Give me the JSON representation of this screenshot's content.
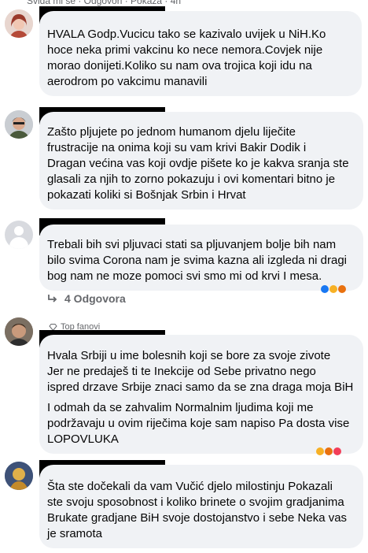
{
  "top_actions": {
    "text": "Sviđa mi se · Odgovori · Pokaža · 4n"
  },
  "comments": [
    {
      "text": "HVALA Godp.Vucicu tako se kazivalo uvijek u NiH.Ko\nhoce neka primi vakcinu ko nece nemora.Covjek nije\nmorao donijeti.Koliko su nam ova trojica koji idu na\naerodrom po vakcimu manavili"
    },
    {
      "text": "Zašto pljujete po jednom humanom djelu liječite\nfrustracije na onima koji su vam krivi Bakir Dodik i\nDragan većina vas koji ovdje pišete ko je kakva sranja ste\nglasali za njih to zorno pokazuju i ovi komentari bitno je\npokazati koliki si Bošnjak Srbin i Hrvat"
    },
    {
      "text": "Trebali bih svi pljuvaci stati sa pljuvanjem bolje bih nam\nbilo svima Corona nam je svima kazna ali izgleda ni dragi\nbog nam ne moze pomoci svi smo mi od krvi I mesa.",
      "replies_label": "4 Odgovora"
    },
    {
      "badge": "Top fanovi",
      "text": "Hvala Srbiji u ime bolesnih koji se bore za svoje zivote\nJer ne predaješ ti te Inekcije od Sebe privatno nego\nispred drzave Srbije znaci samo da se zna draga moja BiH",
      "text2": "I odmah da se zahvalim Normalnim ljudima koji me\npodržavaju u ovim riječima koje sam napiso Pa dosta vise\nLOPOVLUKA"
    },
    {
      "text": "Šta ste dočekali da vam Vučić djelo milostinju Pokazali\nste svoju sposobnost i koliko brinete o svojim gradjanima\nBrukate gradjane BiH svoje dostojanstvo i sebe Neka vas\nje sramota"
    }
  ],
  "colors": {
    "bubble": "#f0f2f5",
    "meta": "#65676b",
    "redaction": "#000000"
  }
}
